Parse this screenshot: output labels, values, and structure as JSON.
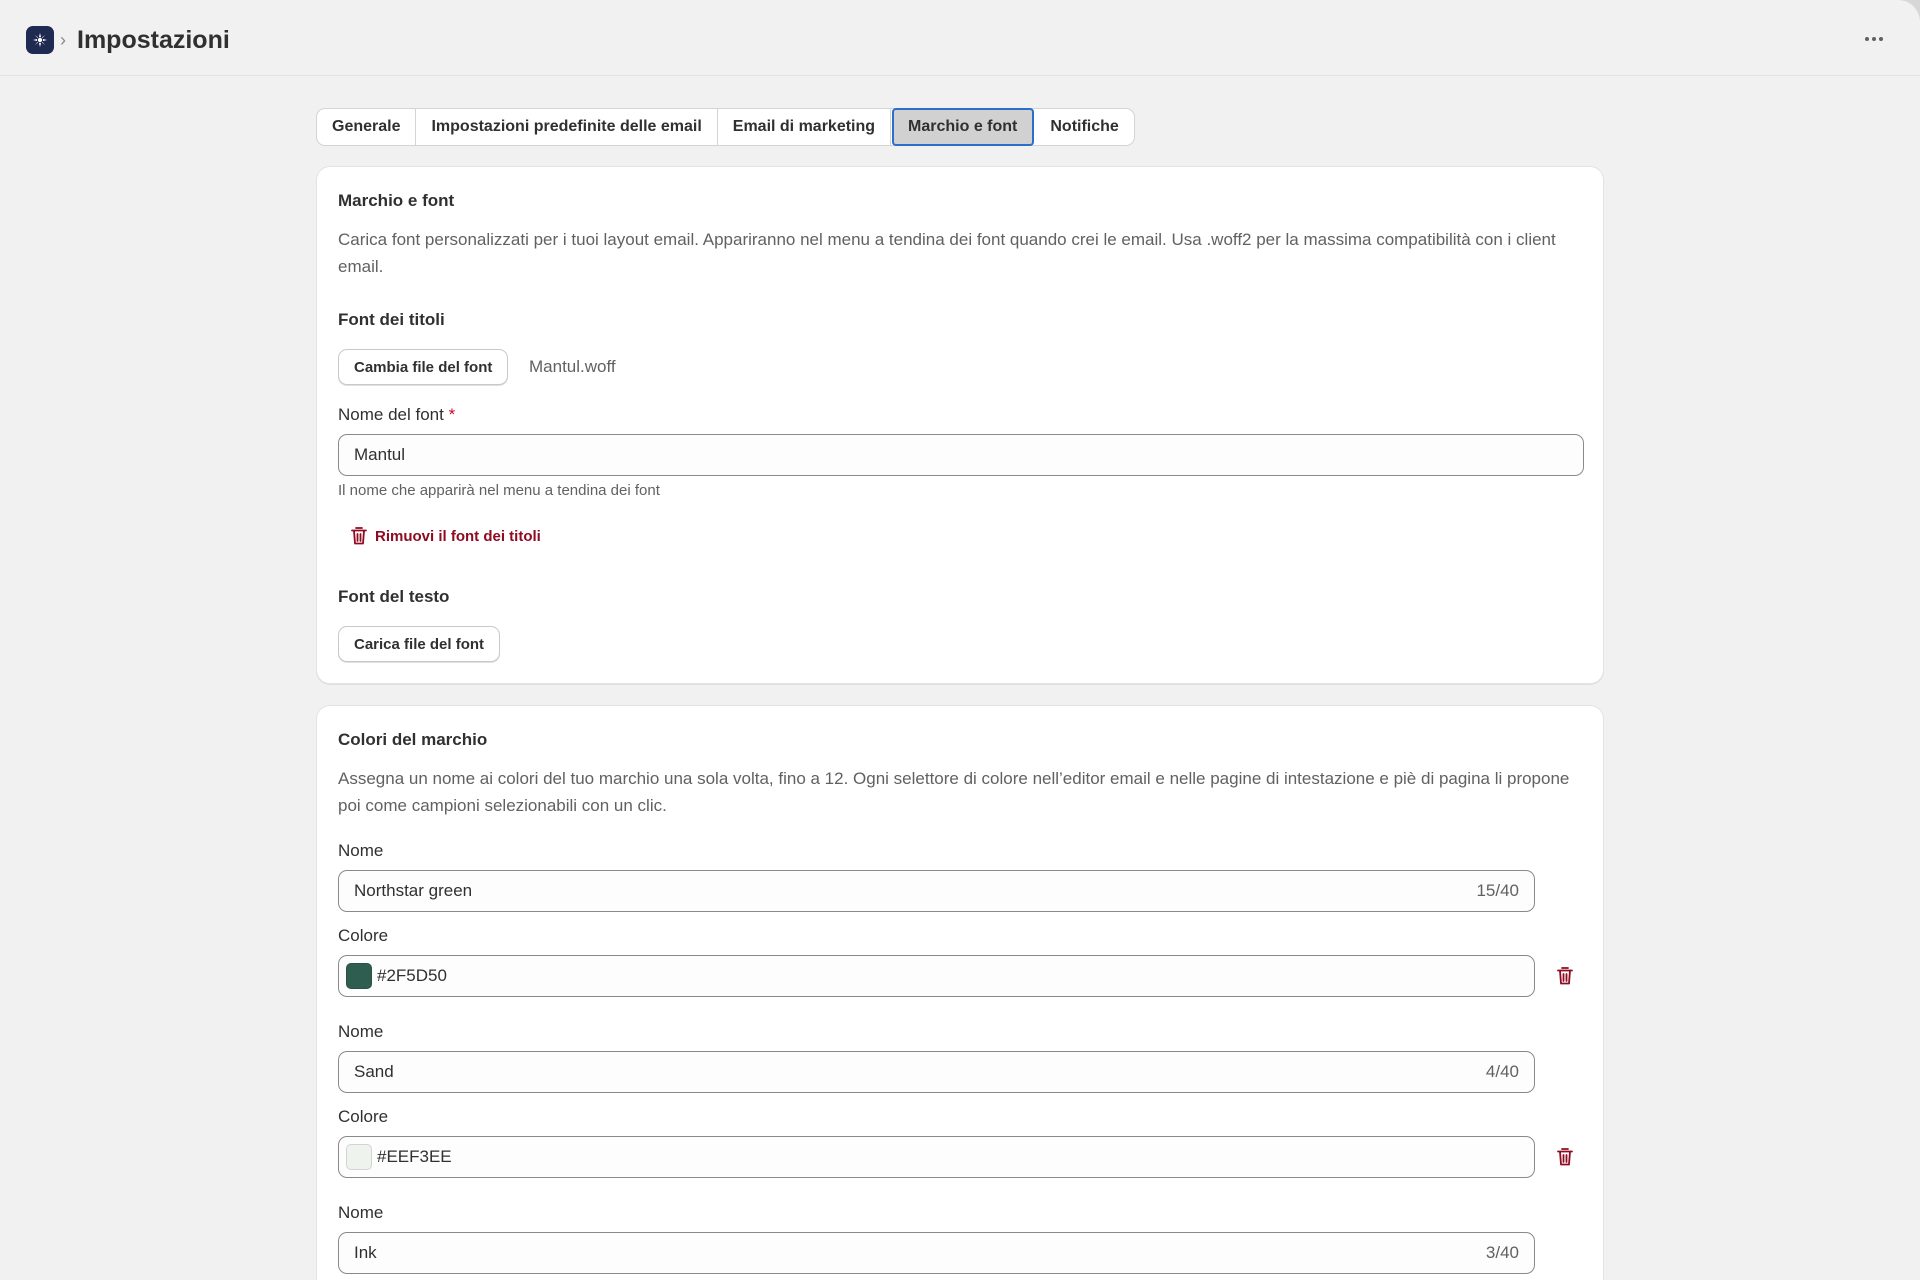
{
  "header": {
    "title": "Impostazioni",
    "chevron": "›"
  },
  "tabs": [
    {
      "label": "Generale",
      "active": false
    },
    {
      "label": "Impostazioni predefinite delle email",
      "active": false
    },
    {
      "label": "Email di marketing",
      "active": false
    },
    {
      "label": "Marchio e font",
      "active": true
    },
    {
      "label": "Notifiche",
      "active": false
    }
  ],
  "fonts_card": {
    "title": "Marchio e font",
    "description": "Carica font personalizzati per i tuoi layout email. Appariranno nel menu a tendina dei font quando crei le email. Usa .woff2 per la massima compatibilità con i client email.",
    "heading_font": {
      "label": "Font dei titoli",
      "change_button": "Cambia file del font",
      "file_name": "Mantul.woff",
      "name_label": "Nome del font",
      "required_mark": "*",
      "name_value": "Mantul",
      "help_text": "Il nome che apparirà nel menu a tendina dei font",
      "remove_label": "Rimuovi il font dei titoli"
    },
    "body_font": {
      "label": "Font del testo",
      "upload_button": "Carica file del font"
    }
  },
  "colors_card": {
    "title": "Colori del marchio",
    "description": "Assegna un nome ai colori del tuo marchio una sola volta, fino a 12. Ogni selettore di colore nell’editor email e nelle pagine di intestazione e piè di pagina li propone poi come campioni selezionabili con un clic.",
    "name_label": "Nome",
    "color_label": "Colore",
    "colors": [
      {
        "name": "Northstar green",
        "count": "15/40",
        "hex": "#2F5D50"
      },
      {
        "name": "Sand",
        "count": "4/40",
        "hex": "#EEF3EE"
      },
      {
        "name": "Ink",
        "count": "3/40"
      }
    ]
  },
  "colors": {
    "accent": "#2c6ecb",
    "danger": "#8e0b21",
    "app_icon": "#1f2a52"
  },
  "icons": {
    "app": "app-logo-icon",
    "more": "more-horizontal-icon",
    "trash": "trash-icon"
  }
}
